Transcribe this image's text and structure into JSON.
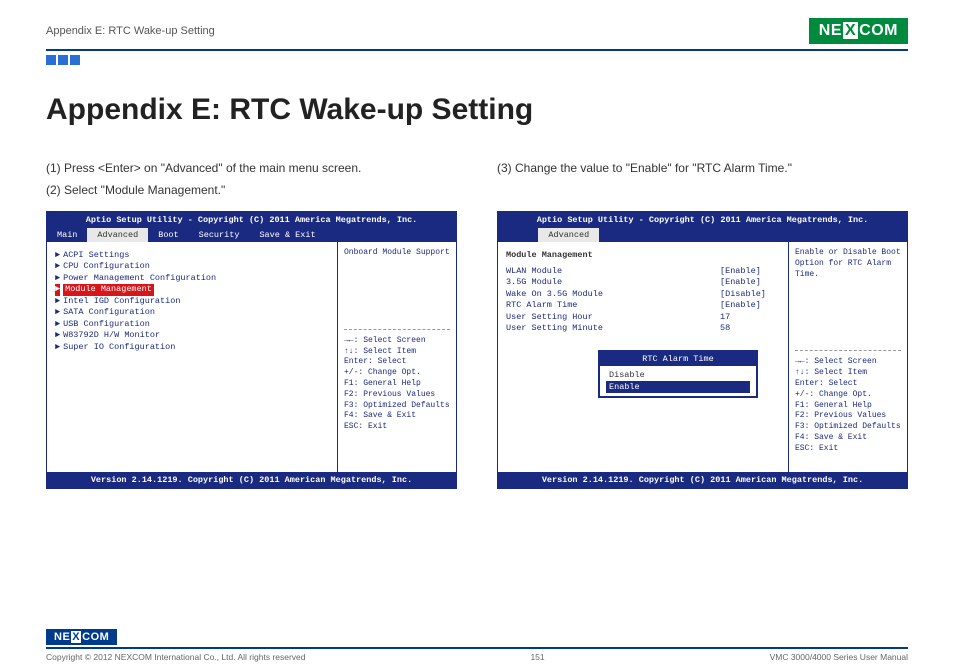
{
  "header": {
    "breadcrumb": "Appendix E: RTC Wake-up Setting",
    "logo_a": "NE",
    "logo_x": "X",
    "logo_b": "COM"
  },
  "title": "Appendix E: RTC Wake-up Setting",
  "left": {
    "step1": "(1) Press <Enter> on \"Advanced\" of the main menu screen.",
    "step2": "(2) Select \"Module Management.\"",
    "bios": {
      "bar": "Aptio Setup Utility - Copyright (C) 2011 America Megatrends, Inc.",
      "tabs": {
        "t0": "Main",
        "t1": "Advanced",
        "t2": "Boot",
        "t3": "Security",
        "t4": "Save & Exit"
      },
      "items": {
        "i0": "ACPI Settings",
        "i1": "CPU Configuration",
        "i2": "Power Management Configuration",
        "i3": "Module Management",
        "i4": "Intel IGD Configuration",
        "i5": "SATA Configuration",
        "i6": "USB Configuration",
        "i7": "W83792D H/W Monitor",
        "i8": "Super IO Configuration"
      },
      "side": "Onboard Module Support",
      "help": {
        "h0": "→←: Select Screen",
        "h1": "↑↓: Select Item",
        "h2": "Enter: Select",
        "h3": "+/-: Change Opt.",
        "h4": "F1: General Help",
        "h5": "F2: Previous Values",
        "h6": "F3: Optimized Defaults",
        "h7": "F4: Save & Exit",
        "h8": "ESC: Exit"
      },
      "ver": "Version 2.14.1219. Copyright (C) 2011 American Megatrends, Inc."
    }
  },
  "right": {
    "step3": "(3) Change the value to \"Enable\" for \"RTC Alarm Time.\"",
    "bios": {
      "bar": "Aptio Setup Utility - Copyright (C) 2011 America Megatrends, Inc.",
      "tab": "Advanced",
      "section": "Module Management",
      "rows": {
        "r0": {
          "l": "WLAN Module",
          "v": "[Enable]"
        },
        "r1": {
          "l": "3.5G Module",
          "v": "[Enable]"
        },
        "r2": {
          "l": "Wake On 3.5G Module",
          "v": "[Disable]"
        },
        "r3": {
          "l": "RTC Alarm Time",
          "v": "[Enable]"
        },
        "r4": {
          "l": "User Setting Hour",
          "v": "17"
        },
        "r5": {
          "l": "User Setting Minute",
          "v": "58"
        }
      },
      "popup": {
        "title": "RTC Alarm Time",
        "o0": "Disable",
        "o1": "Enable"
      },
      "side": "Enable or Disable Boot Option for RTC Alarm Time.",
      "help": {
        "h0": "→←: Select Screen",
        "h1": "↑↓: Select Item",
        "h2": "Enter: Select",
        "h3": "+/-: Change Opt.",
        "h4": "F1: General Help",
        "h5": "F2: Previous Values",
        "h6": "F3: Optimized Defaults",
        "h7": "F4: Save & Exit",
        "h8": "ESC: Exit"
      },
      "ver": "Version 2.14.1219. Copyright (C) 2011 American Megatrends, Inc."
    }
  },
  "footer": {
    "logo_a": "NE",
    "logo_x": "X",
    "logo_b": "COM",
    "copy": "Copyright © 2012 NEXCOM International Co., Ltd. All rights reserved",
    "page": "151",
    "manual": "VMC 3000/4000 Series User Manual"
  }
}
